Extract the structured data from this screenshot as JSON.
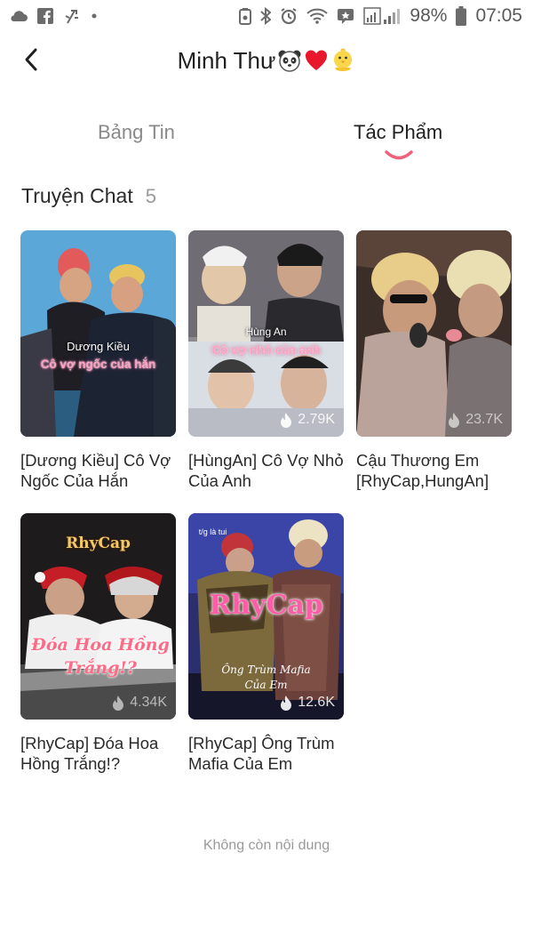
{
  "status_bar": {
    "battery_percent": "98%",
    "time": "07:05",
    "left_icons": [
      "cloud-icon",
      "facebook-icon",
      "usb-icon",
      "dot-icon"
    ],
    "right_icons": [
      "nfc-icon",
      "bluetooth-icon",
      "alarm-icon",
      "wifi-icon",
      "message-icon",
      "signal-icon",
      "battery-icon"
    ]
  },
  "header": {
    "title": "Minh Thư",
    "title_emojis": [
      "panda-icon",
      "heart-icon",
      "chick-icon"
    ]
  },
  "tabs": [
    {
      "label": "Bảng Tin",
      "active": false
    },
    {
      "label": "Tác Phẩm",
      "active": true
    }
  ],
  "section": {
    "title": "Truyện Chat",
    "count": "5"
  },
  "stories": [
    {
      "title": "[Dương Kiều] Cô Vợ Ngốc Của Hắn",
      "views": "",
      "cover_name": "Dương Kiều",
      "cover_subtitle": "Cô vợ ngốc của hắn"
    },
    {
      "title": "[HùngAn] Cô Vợ Nhỏ Của Anh",
      "views": "2.79K",
      "cover_name": "Hùng An",
      "cover_subtitle": "Cô vợ nhỏ của anh"
    },
    {
      "title": "Cậu Thương Em [RhyCap,HungAn]",
      "views": "23.7K"
    },
    {
      "title": "[RhyCap] Đóa Hoa Hồng Trắng!?",
      "views": "4.34K",
      "cover_name": "RhyCap",
      "cover_subtitle": "Đóa Hoa Hồng Trắng!?"
    },
    {
      "title": "[RhyCap] Ông Trùm Mafia Của Em",
      "views": "12.6K",
      "cover_name": "RhyCap",
      "cover_subtitle": "Ông Trùm Mafia Của Em",
      "cover_tag": "t/g là tui"
    }
  ],
  "footer": {
    "end_note": "Không còn nội dung"
  },
  "colors": {
    "accent": "#f0607a",
    "text_primary": "#1f1f1f",
    "text_muted": "#8a8a8a"
  }
}
